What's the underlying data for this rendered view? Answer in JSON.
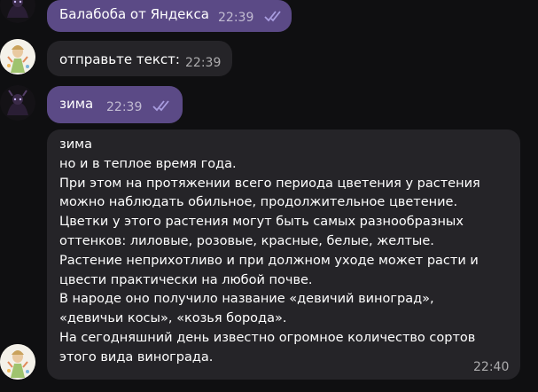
{
  "messages": [
    {
      "from": "user",
      "text": "Балабоба от Яндекса",
      "time": "22:39",
      "status_icon": "double-check-icon"
    },
    {
      "from": "bot",
      "text": "отправьте текст:",
      "time": "22:39"
    },
    {
      "from": "user",
      "text": "зима",
      "time": "22:39",
      "status_icon": "double-check-icon"
    },
    {
      "from": "bot",
      "text": "зима\nно и в теплое время года.\nПри этом на протяжении всего периода цветения у растения\nможно наблюдать обильное, продолжительное цветение.\nЦветки у этого растения могут быть самых разнообразных\nоттенков: лиловые, розовые, красные, белые, желтые.\nРастение неприхотливо и при должном уходе может расти и\nцвести практически на любой почве.\nВ народе оно получило название «девичий виноград»,\n«девичьи косы», «козья борода».\nНа сегодняшний день известно огромное количество сортов\nэтого вида винограда.",
      "time": "22:40"
    }
  ],
  "colors": {
    "background": "#0f0f11",
    "outgoing_bubble": "#5b4a86",
    "incoming_bubble": "#252428",
    "check_color": "#a99de0"
  }
}
